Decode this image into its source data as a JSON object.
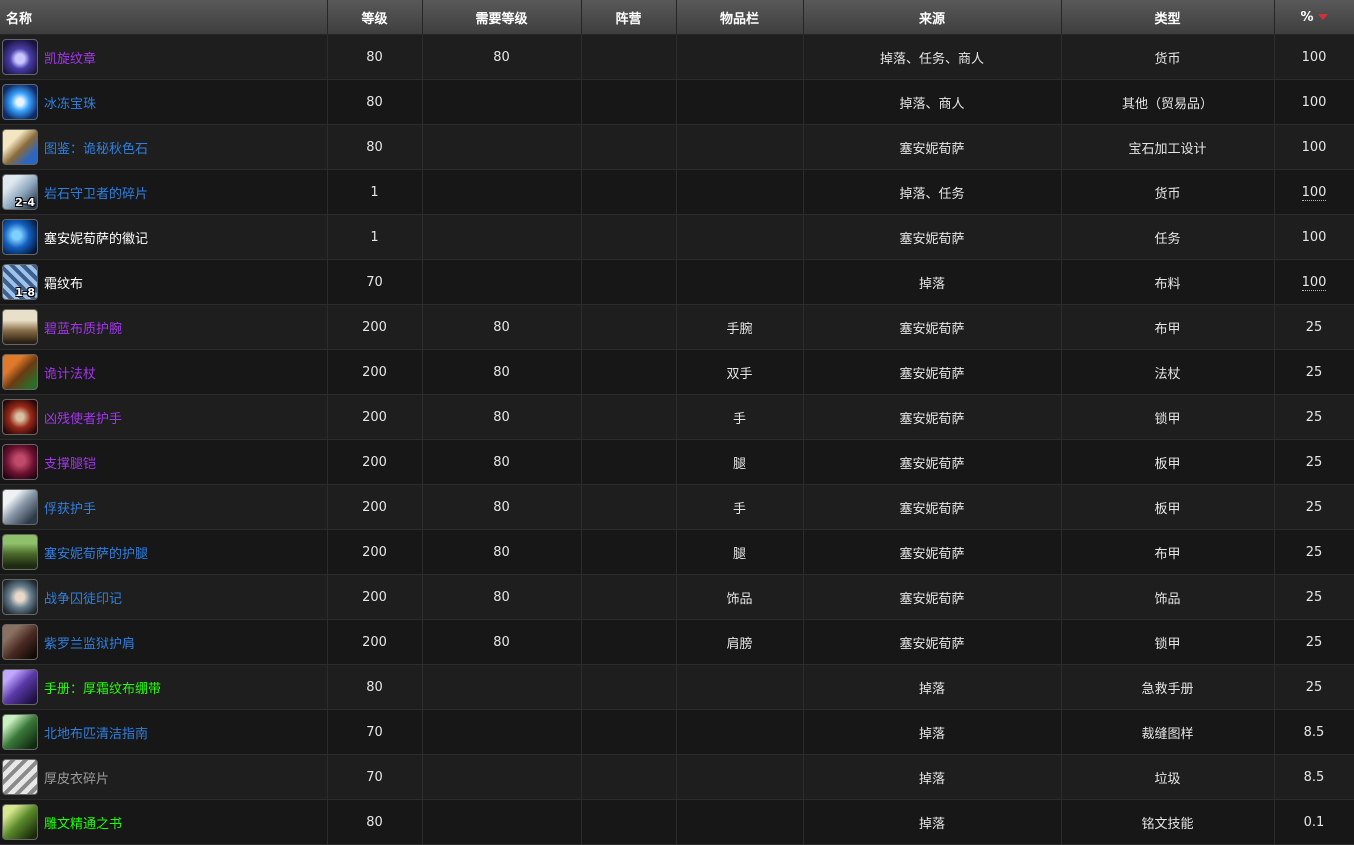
{
  "headers": {
    "name": "名称",
    "level": "等级",
    "req_level": "需要等级",
    "side": "阵营",
    "slot": "物品栏",
    "source": "来源",
    "type": "类型",
    "percent": "%"
  },
  "colors": {
    "epic": "#a335ee",
    "rare": "#2f7fe0",
    "common": "#ffffff",
    "uncommon": "#1eff00",
    "poor": "#9d9d9d",
    "sort_arrow": "#d0303a"
  },
  "rows": [
    {
      "name": "凯旋纹章",
      "quality": "epic",
      "icon": "helm-emblem-icon",
      "stack": "",
      "level": "80",
      "req": "80",
      "side": "",
      "slot": "",
      "source": "掉落、任务、商人",
      "type": "货币",
      "pct": "100",
      "pct_dotted": false
    },
    {
      "name": "冰冻宝珠",
      "quality": "rare",
      "icon": "frozen-orb-icon",
      "stack": "",
      "level": "80",
      "req": "",
      "side": "",
      "slot": "",
      "source": "掉落、商人",
      "type": "其他（贸易品）",
      "pct": "100",
      "pct_dotted": false
    },
    {
      "name": "图鉴：诡秘秋色石",
      "quality": "rare",
      "icon": "scroll-design-icon",
      "stack": "",
      "level": "80",
      "req": "",
      "side": "",
      "slot": "",
      "source": "塞安妮荀萨",
      "type": "宝石加工设计",
      "pct": "100",
      "pct_dotted": false
    },
    {
      "name": "岩石守卫者的碎片",
      "quality": "rare",
      "icon": "stone-shard-icon",
      "stack": "2-4",
      "level": "1",
      "req": "",
      "side": "",
      "slot": "",
      "source": "掉落、任务",
      "type": "货币",
      "pct": "100",
      "pct_dotted": true
    },
    {
      "name": "塞安妮荀萨的徽记",
      "quality": "common",
      "icon": "sigil-icon",
      "stack": "",
      "level": "1",
      "req": "",
      "side": "",
      "slot": "",
      "source": "塞安妮荀萨",
      "type": "任务",
      "pct": "100",
      "pct_dotted": false
    },
    {
      "name": "霜纹布",
      "quality": "common",
      "icon": "frostweave-cloth-icon",
      "stack": "1-8",
      "level": "70",
      "req": "",
      "side": "",
      "slot": "",
      "source": "掉落",
      "type": "布料",
      "pct": "100",
      "pct_dotted": true
    },
    {
      "name": "碧蓝布质护腕",
      "quality": "epic",
      "icon": "bracer-icon",
      "stack": "",
      "level": "200",
      "req": "80",
      "side": "",
      "slot": "手腕",
      "source": "塞安妮荀萨",
      "type": "布甲",
      "pct": "25",
      "pct_dotted": false
    },
    {
      "name": "诡计法杖",
      "quality": "epic",
      "icon": "staff-icon",
      "stack": "",
      "level": "200",
      "req": "80",
      "side": "",
      "slot": "双手",
      "source": "塞安妮荀萨",
      "type": "法杖",
      "pct": "25",
      "pct_dotted": false
    },
    {
      "name": "凶残使者护手",
      "quality": "epic",
      "icon": "gauntlet-red-icon",
      "stack": "",
      "level": "200",
      "req": "80",
      "side": "",
      "slot": "手",
      "source": "塞安妮荀萨",
      "type": "锁甲",
      "pct": "25",
      "pct_dotted": false
    },
    {
      "name": "支撑腿铠",
      "quality": "epic",
      "icon": "leg-plate-icon",
      "stack": "",
      "level": "200",
      "req": "80",
      "side": "",
      "slot": "腿",
      "source": "塞安妮荀萨",
      "type": "板甲",
      "pct": "25",
      "pct_dotted": false
    },
    {
      "name": "俘获护手",
      "quality": "rare",
      "icon": "gauntlet-steel-icon",
      "stack": "",
      "level": "200",
      "req": "80",
      "side": "",
      "slot": "手",
      "source": "塞安妮荀萨",
      "type": "板甲",
      "pct": "25",
      "pct_dotted": false
    },
    {
      "name": "塞安妮荀萨的护腿",
      "quality": "rare",
      "icon": "pants-green-icon",
      "stack": "",
      "level": "200",
      "req": "80",
      "side": "",
      "slot": "腿",
      "source": "塞安妮荀萨",
      "type": "布甲",
      "pct": "25",
      "pct_dotted": false
    },
    {
      "name": "战争囚徒印记",
      "quality": "rare",
      "icon": "trinket-icon",
      "stack": "",
      "level": "200",
      "req": "80",
      "side": "",
      "slot": "饰品",
      "source": "塞安妮荀萨",
      "type": "饰品",
      "pct": "25",
      "pct_dotted": false
    },
    {
      "name": "紫罗兰监狱护肩",
      "quality": "rare",
      "icon": "shoulder-icon",
      "stack": "",
      "level": "200",
      "req": "80",
      "side": "",
      "slot": "肩膀",
      "source": "塞安妮荀萨",
      "type": "锁甲",
      "pct": "25",
      "pct_dotted": false
    },
    {
      "name": "手册：厚霜纹布绷带",
      "quality": "uncommon",
      "icon": "manual-purple-icon",
      "stack": "",
      "level": "80",
      "req": "",
      "side": "",
      "slot": "",
      "source": "掉落",
      "type": "急救手册",
      "pct": "25",
      "pct_dotted": false
    },
    {
      "name": "北地布匹清洁指南",
      "quality": "rare",
      "icon": "pattern-book-icon",
      "stack": "",
      "level": "70",
      "req": "",
      "side": "",
      "slot": "",
      "source": "掉落",
      "type": "裁缝图样",
      "pct": "8.5",
      "pct_dotted": false
    },
    {
      "name": "厚皮衣碎片",
      "quality": "poor",
      "icon": "leather-scrap-icon",
      "stack": "",
      "level": "70",
      "req": "",
      "side": "",
      "slot": "",
      "source": "掉落",
      "type": "垃圾",
      "pct": "8.5",
      "pct_dotted": false
    },
    {
      "name": "雕文精通之书",
      "quality": "uncommon",
      "icon": "glyph-book-icon",
      "stack": "",
      "level": "80",
      "req": "",
      "side": "",
      "slot": "",
      "source": "掉落",
      "type": "铭文技能",
      "pct": "0.1",
      "pct_dotted": false
    }
  ]
}
